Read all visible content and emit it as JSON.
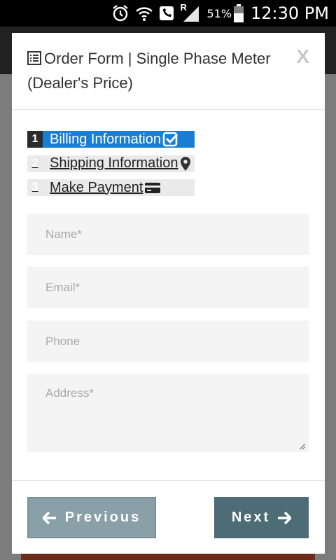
{
  "status_bar": {
    "battery_percent": "51%",
    "time": "12:30 PM",
    "roaming_indicator": "R",
    "icons": [
      "alarm-icon",
      "wifi-icon",
      "wifi-call-icon",
      "signal-icon",
      "battery-icon"
    ]
  },
  "modal": {
    "title": "Order Form | Single Phase Meter (Dealer's Price)",
    "title_icon": "list-alt-icon",
    "close_label": "X",
    "steps": [
      {
        "number": "1",
        "label": "Billing Information",
        "icon": "check-square-icon",
        "active": true
      },
      {
        "number": "2",
        "label": "Shipping Information",
        "icon": "map-marker-icon",
        "active": false
      },
      {
        "number": "3",
        "label": "Make Payment",
        "icon": "credit-card-icon",
        "active": false
      }
    ],
    "form": {
      "name": {
        "placeholder": "Name*",
        "value": ""
      },
      "email": {
        "placeholder": "Email*",
        "value": ""
      },
      "phone": {
        "placeholder": "Phone",
        "value": ""
      },
      "address": {
        "placeholder": "Address*",
        "value": ""
      }
    },
    "footer": {
      "previous_label": "Previous",
      "next_label": "Next"
    }
  },
  "colors": {
    "active_step": "#1a7fd4",
    "previous_button": "#8aa0a8",
    "next_button": "#4d6c76",
    "field_background": "#f4f4f4"
  }
}
